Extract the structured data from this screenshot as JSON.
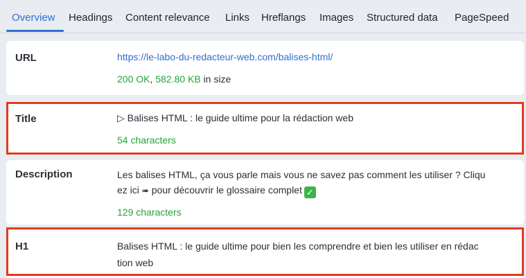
{
  "tabs": [
    {
      "label": "Overview"
    },
    {
      "label": "Headings"
    },
    {
      "label": "Content relevance"
    },
    {
      "label": "Links"
    },
    {
      "label": "Hreflangs"
    },
    {
      "label": "Images"
    },
    {
      "label": "Structured data"
    },
    {
      "label": "PageSpeed"
    }
  ],
  "active_tab": "Overview",
  "url_section": {
    "label": "URL",
    "url": "https://le-labo-du-redacteur-web.com/balises-html/",
    "status": "200 OK",
    "sep": ", ",
    "size": "582.80 KB",
    "size_suffix": " in size"
  },
  "title_section": {
    "label": "Title",
    "prefix_icon": "play-outline-icon",
    "prefix_glyph": "▷",
    "text": "Balises HTML : le guide ultime pour la rédaction web",
    "count": "54 characters"
  },
  "description_section": {
    "label": "Description",
    "line1": "Les balises HTML, ça vous parle mais vous ne savez pas comment les utiliser ? Cliqu",
    "line2_before": "ez ici ",
    "arrow_glyph": "➠",
    "line2_after": " pour découvrir le glossaire complet",
    "check_glyph": "✓",
    "count": "129 characters"
  },
  "h1_section": {
    "label": "H1",
    "line1": "Balises HTML : le guide ultime pour bien les comprendre et bien les utiliser en rédac",
    "line2": "tion web"
  },
  "colors": {
    "accent": "#2f6fd1",
    "success": "#22a43a",
    "highlight": "#e23a1f",
    "background": "#e9ecf1"
  }
}
